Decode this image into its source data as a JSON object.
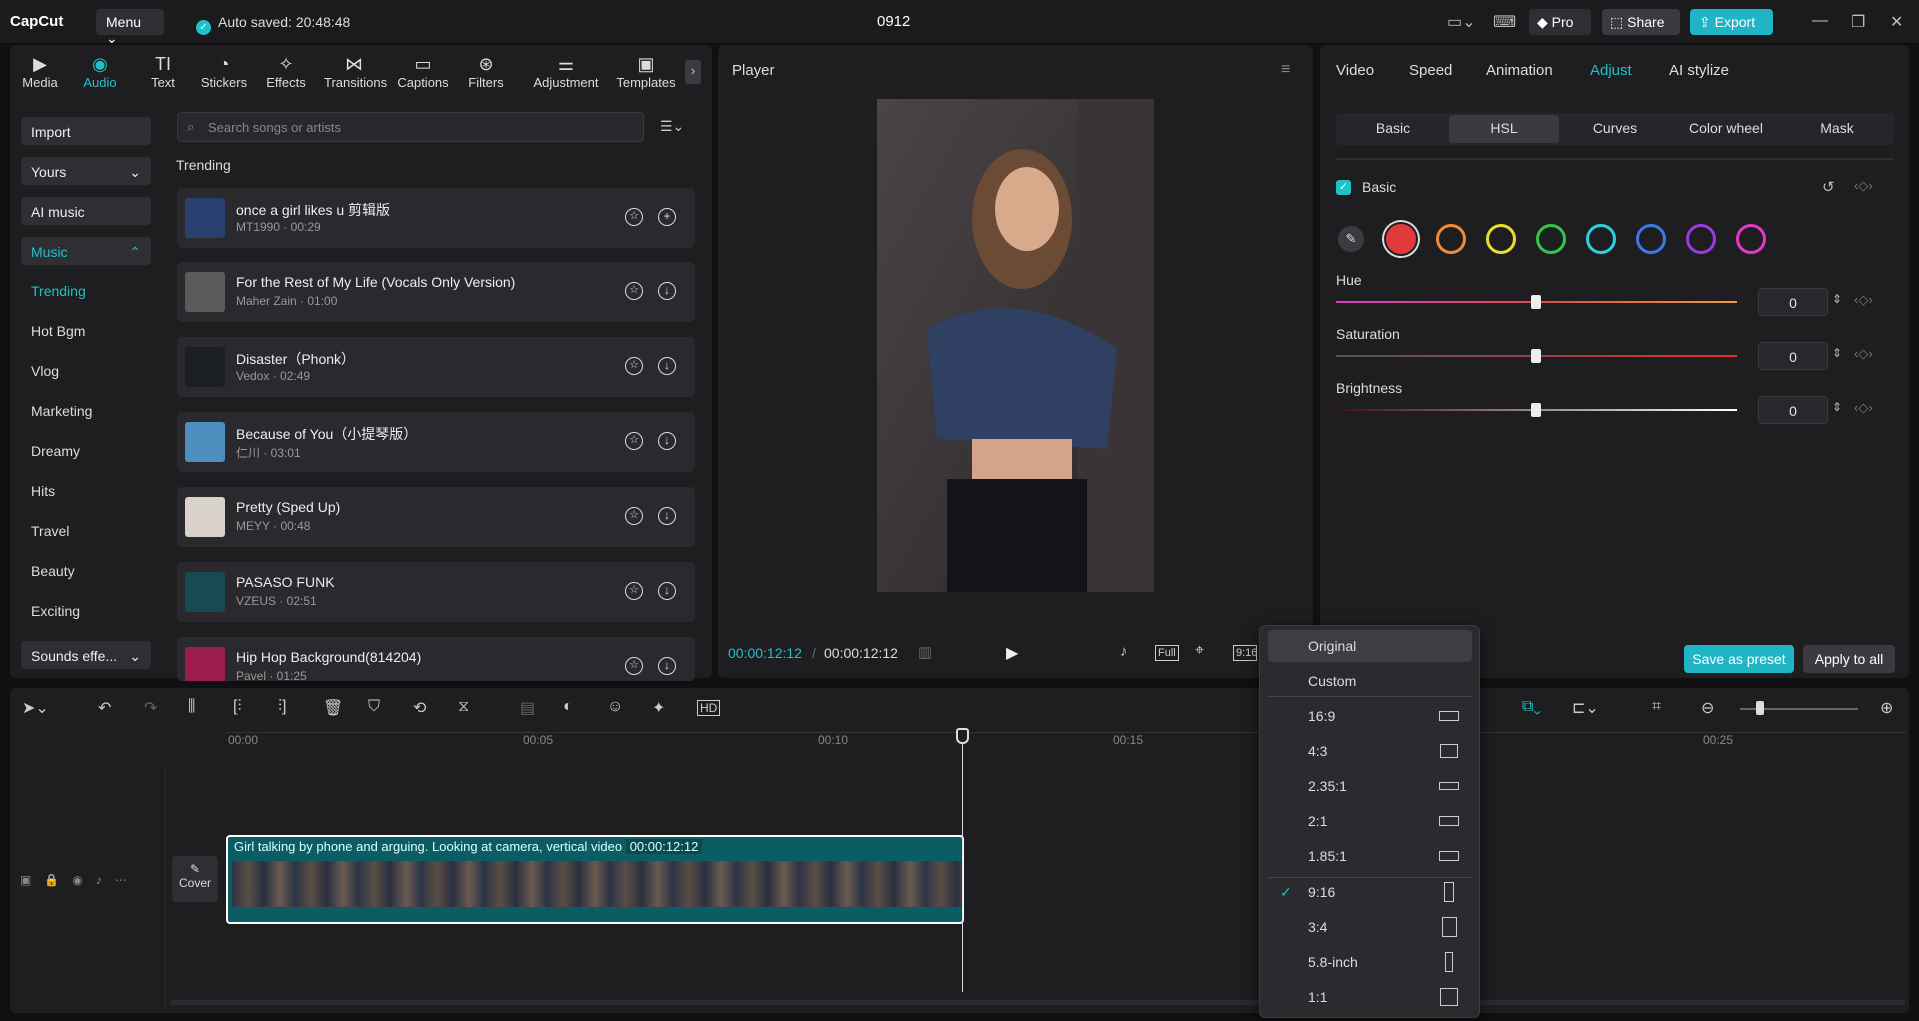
{
  "app": {
    "logo": "CapCut",
    "menu_label": "Menu",
    "autosave": "Auto saved: 20:48:48",
    "project_title": "0912",
    "pro_label": "Pro",
    "share_label": "Share",
    "export_label": "Export"
  },
  "toolbar": [
    {
      "label": "Media",
      "icon": "media-icon"
    },
    {
      "label": "Audio",
      "icon": "audio-icon",
      "active": true
    },
    {
      "label": "Text",
      "icon": "text-icon"
    },
    {
      "label": "Stickers",
      "icon": "stickers-icon"
    },
    {
      "label": "Effects",
      "icon": "effects-icon"
    },
    {
      "label": "Transitions",
      "icon": "transitions-icon"
    },
    {
      "label": "Captions",
      "icon": "captions-icon"
    },
    {
      "label": "Filters",
      "icon": "filters-icon"
    },
    {
      "label": "Adjustment",
      "icon": "adjustment-icon"
    },
    {
      "label": "Templates",
      "icon": "templates-icon"
    }
  ],
  "left_nav": {
    "import": "Import",
    "yours": "Yours",
    "ai_music": "AI music",
    "music": "Music",
    "items": [
      "Trending",
      "Hot Bgm",
      "Vlog",
      "Marketing",
      "Dreamy",
      "Hits",
      "Travel",
      "Beauty",
      "Exciting"
    ],
    "sounds": "Sounds effe..."
  },
  "search": {
    "placeholder": "Search songs or artists"
  },
  "section_title": "Trending",
  "songs": [
    {
      "title": "once a girl likes u 剪辑版",
      "sub": "MT1990 · 00:29",
      "thumb": "#27406f",
      "action": "+"
    },
    {
      "title": "For the Rest of My Life (Vocals Only Version)",
      "sub": "Maher Zain · 01:00",
      "thumb": "#5a5a5a",
      "action": "↓"
    },
    {
      "title": "Disaster（Phonk）",
      "sub": "Vedox · 02:49",
      "thumb": "#1b1e22",
      "action": "↓"
    },
    {
      "title": "Because of You（小提琴版）",
      "sub": "仁川 · 03:01",
      "thumb": "#4f8fbf",
      "action": "↓"
    },
    {
      "title": "Pretty (Sped Up)",
      "sub": "MEYY · 00:48",
      "thumb": "#d8d2c8",
      "action": "↓"
    },
    {
      "title": "PASASO FUNK",
      "sub": "VZEUS · 02:51",
      "thumb": "#174a52",
      "action": "↓"
    },
    {
      "title": "Hip Hop Background(814204)",
      "sub": "Pavel · 01:25",
      "thumb": "#9e1d4f",
      "action": "↓"
    }
  ],
  "player": {
    "title": "Player",
    "current_time": "00:00:12:12",
    "total_time": "00:00:12:12",
    "full_label": "Full",
    "ratio_label": "9:16"
  },
  "right_panel": {
    "tabs": [
      "Video",
      "Speed",
      "Animation",
      "Adjust",
      "AI stylize"
    ],
    "active_tab": "Adjust",
    "subtabs": [
      "Basic",
      "HSL",
      "Curves",
      "Color wheel",
      "Mask"
    ],
    "active_subtab": "HSL",
    "basic_label": "Basic",
    "swatches": [
      "#e03a3a",
      "#f08a3a",
      "#e8e02a",
      "#34c64a",
      "#2ad2e0",
      "#3a7ae8",
      "#9a3ae0",
      "#e03ac8"
    ],
    "hue": {
      "label": "Hue",
      "value": "0"
    },
    "saturation": {
      "label": "Saturation",
      "value": "0"
    },
    "brightness": {
      "label": "Brightness",
      "value": "0"
    },
    "save_preset": "Save as preset",
    "apply_all": "Apply to all"
  },
  "timeline": {
    "ruler": [
      "00:00",
      "00:05",
      "00:10",
      "00:15",
      "00:25"
    ],
    "clip_title": "Girl talking by phone and arguing. Looking at camera, vertical video",
    "clip_duration": "00:00:12:12",
    "cover_label": "Cover"
  },
  "ratio_menu": {
    "items": [
      "Original",
      "Custom",
      "16:9",
      "4:3",
      "2.35:1",
      "2:1",
      "1.85:1",
      "9:16",
      "3:4",
      "5.8-inch",
      "1:1"
    ],
    "selected": "9:16"
  },
  "colors": {
    "accent": "#1fc2c8",
    "bg": "#101012",
    "panel": "#1e1e21"
  }
}
